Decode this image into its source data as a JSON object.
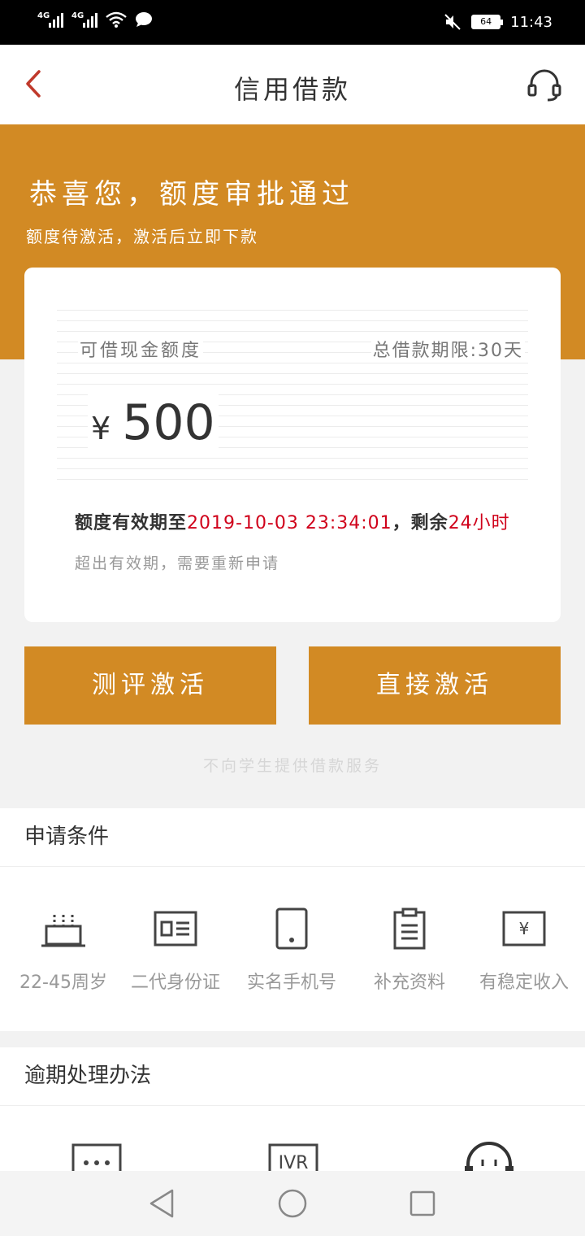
{
  "status_bar": {
    "sim1": "4G",
    "sim2": "4G",
    "battery": "64",
    "time": "11:43"
  },
  "header": {
    "title": "信用借款",
    "back_icon": "chevron-left-icon",
    "service_icon": "headset-icon"
  },
  "banner": {
    "title": "恭喜您，额度审批通过",
    "subtitle": "额度待激活，激活后立即下款"
  },
  "card": {
    "label": "可借现金额度",
    "term": "总借款期限:30天",
    "currency": "¥",
    "amount": "500",
    "validity_prefix": "额度有效期至",
    "validity_date": "2019-10-03 23:34:01",
    "remaining_prefix": "，剩余",
    "remaining": "24小时",
    "expire_note": "超出有效期，需要重新申请"
  },
  "buttons": {
    "evaluate": "测评激活",
    "direct": "直接激活"
  },
  "notice": "不向学生提供借款服务",
  "conditions": {
    "heading": "申请条件",
    "items": [
      {
        "label": "22-45周岁",
        "icon": "birthday-cake-icon"
      },
      {
        "label": "二代身份证",
        "icon": "id-card-icon"
      },
      {
        "label": "实名手机号",
        "icon": "mobile-phone-icon"
      },
      {
        "label": "补充资料",
        "icon": "clipboard-icon"
      },
      {
        "label": "有稳定收入",
        "icon": "yen-bill-icon"
      }
    ]
  },
  "overdue": {
    "heading": "逾期处理办法",
    "items": [
      {
        "icon": "sms-message-icon"
      },
      {
        "icon": "ivr-call-icon",
        "text": "IVR"
      },
      {
        "icon": "headset-icon"
      }
    ]
  },
  "colors": {
    "accent": "#d28a24",
    "alert": "#d0021b",
    "back_arrow": "#c0392b"
  }
}
